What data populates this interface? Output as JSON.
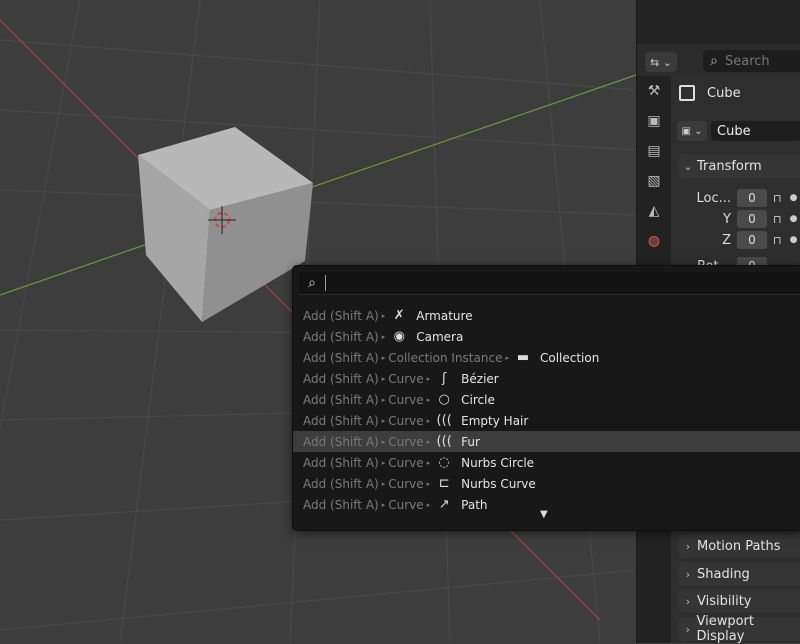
{
  "properties": {
    "search_placeholder": "Search",
    "object_name": "Cube",
    "datablock_name": "Cube",
    "panels": {
      "transform": "Transform",
      "motion_paths": "Motion Paths",
      "shading": "Shading",
      "visibility": "Visibility",
      "viewport_display": "Viewport Display"
    },
    "transform_rows": [
      {
        "label": "Loc...",
        "value": "0"
      },
      {
        "label": "Y",
        "value": "0"
      },
      {
        "label": "Z",
        "value": "0"
      },
      {
        "label": "Rot...",
        "value": "0"
      }
    ],
    "tabs": [
      "tool-icon",
      "render-icon",
      "output-icon",
      "view-layer-icon",
      "scene-icon",
      "world-icon"
    ]
  },
  "add_menu": {
    "items": [
      {
        "crumbs": [
          "Add (Shift A)"
        ],
        "icon": "armature-icon",
        "glyph": "✗",
        "label": "Armature"
      },
      {
        "crumbs": [
          "Add (Shift A)"
        ],
        "icon": "camera-icon",
        "glyph": "◉",
        "label": "Camera"
      },
      {
        "crumbs": [
          "Add (Shift A)",
          "Collection Instance"
        ],
        "icon": "collection-icon",
        "glyph": "▬",
        "label": "Collection"
      },
      {
        "crumbs": [
          "Add (Shift A)",
          "Curve"
        ],
        "icon": "bezier-icon",
        "glyph": "ʃ",
        "label": "Bézier"
      },
      {
        "crumbs": [
          "Add (Shift A)",
          "Curve"
        ],
        "icon": "circle-curve-icon",
        "glyph": "○",
        "label": "Circle"
      },
      {
        "crumbs": [
          "Add (Shift A)",
          "Curve"
        ],
        "icon": "empty-hair-icon",
        "glyph": "(((",
        "label": "Empty Hair"
      },
      {
        "crumbs": [
          "Add (Shift A)",
          "Curve"
        ],
        "icon": "fur-icon",
        "glyph": "(((",
        "label": "Fur",
        "highlighted": true
      },
      {
        "crumbs": [
          "Add (Shift A)",
          "Curve"
        ],
        "icon": "nurbs-circle-icon",
        "glyph": "◌",
        "label": "Nurbs Circle"
      },
      {
        "crumbs": [
          "Add (Shift A)",
          "Curve"
        ],
        "icon": "nurbs-curve-icon",
        "glyph": "⊏",
        "label": "Nurbs Curve"
      },
      {
        "crumbs": [
          "Add (Shift A)",
          "Curve"
        ],
        "icon": "path-icon",
        "glyph": "↗",
        "label": "Path"
      }
    ]
  },
  "colors": {
    "x_axis": "#a0454a",
    "y_axis": "#6a9a3a",
    "viewport_bg": "#3d3d3d"
  }
}
